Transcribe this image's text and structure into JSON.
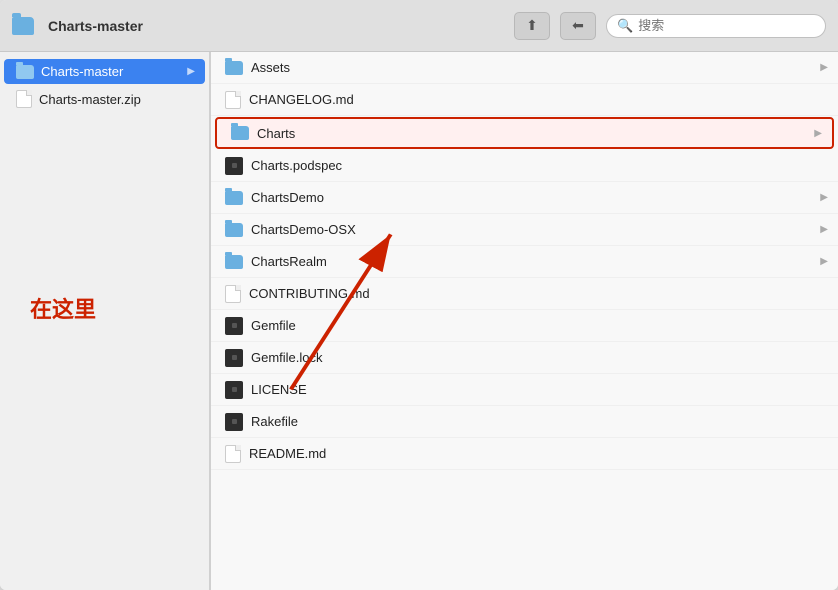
{
  "window": {
    "title": "Charts-master",
    "search_placeholder": "搜索"
  },
  "toolbar": {
    "share_btn": "⬆",
    "back_btn": "⬅"
  },
  "sidebar": {
    "items": [
      {
        "id": "charts-master-folder",
        "label": "Charts-master",
        "type": "folder",
        "selected": true,
        "has_arrow": true
      },
      {
        "id": "charts-master-zip",
        "label": "Charts-master.zip",
        "type": "file",
        "selected": false,
        "has_arrow": false
      }
    ]
  },
  "right_panel": {
    "items": [
      {
        "id": "assets",
        "label": "Assets",
        "type": "folder",
        "has_arrow": true
      },
      {
        "id": "changelog",
        "label": "CHANGELOG.md",
        "type": "file-plain",
        "has_arrow": false
      },
      {
        "id": "charts",
        "label": "Charts",
        "type": "folder",
        "has_arrow": true,
        "highlighted": true
      },
      {
        "id": "charts-podspec",
        "label": "Charts.podspec",
        "type": "file-dark",
        "has_arrow": false
      },
      {
        "id": "charts-demo",
        "label": "ChartsDemo",
        "type": "folder",
        "has_arrow": true
      },
      {
        "id": "charts-demo-osx",
        "label": "ChartsDemo-OSX",
        "type": "folder",
        "has_arrow": true
      },
      {
        "id": "charts-realm",
        "label": "ChartsRealm",
        "type": "folder",
        "has_arrow": true
      },
      {
        "id": "contributing",
        "label": "CONTRIBUTING.md",
        "type": "file-plain",
        "has_arrow": false
      },
      {
        "id": "gemfile",
        "label": "Gemfile",
        "type": "file-dark",
        "has_arrow": false
      },
      {
        "id": "gemfile-lock",
        "label": "Gemfile.lock",
        "type": "file-dark",
        "has_arrow": false
      },
      {
        "id": "license",
        "label": "LICENSE",
        "type": "file-dark",
        "has_arrow": false
      },
      {
        "id": "rakefile",
        "label": "Rakefile",
        "type": "file-dark",
        "has_arrow": false
      },
      {
        "id": "readme",
        "label": "README.md",
        "type": "file-plain",
        "has_arrow": false
      }
    ]
  },
  "annotation": {
    "label": "在这里",
    "color": "#cc2200"
  }
}
